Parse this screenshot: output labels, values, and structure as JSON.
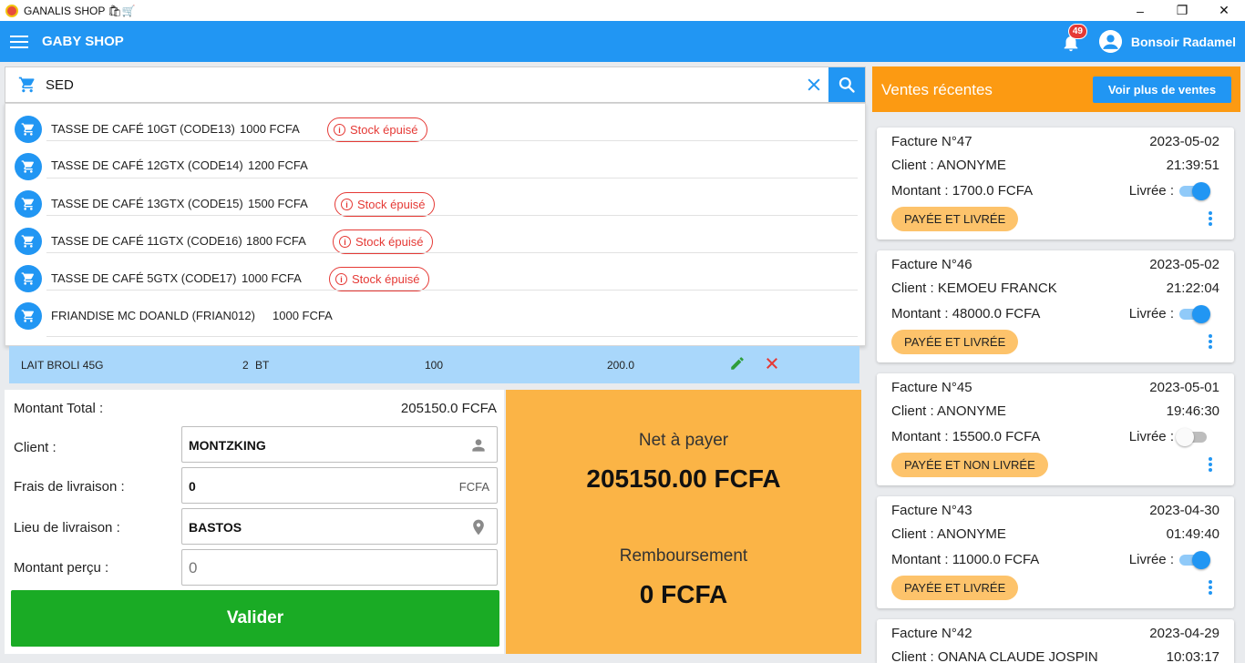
{
  "window": {
    "title": "GANALIS SHOP 🛍🛒",
    "minimize": "–",
    "restore": "❐",
    "close": "✕"
  },
  "appbar": {
    "app_name": "GABY SHOP",
    "notification_count": "49",
    "greeting": "Bonsoir Radamel"
  },
  "search": {
    "value": "SED"
  },
  "suggestions": [
    {
      "name": "TASSE DE CAFÉ 10GT (CODE13)",
      "price": "1000 FCFA",
      "stock": "Stock épuisé"
    },
    {
      "name": "TASSE DE CAFÉ 12GTX (CODE14)",
      "price": "1200 FCFA",
      "stock": ""
    },
    {
      "name": "TASSE DE CAFÉ 13GTX (CODE15)",
      "price": "1500 FCFA",
      "stock": "Stock épuisé"
    },
    {
      "name": "TASSE DE CAFÉ 11GTX (CODE16)",
      "price": "1800 FCFA",
      "stock": "Stock épuisé"
    },
    {
      "name": "TASSE DE CAFÉ 5GTX (CODE17)",
      "price": "1000 FCFA",
      "stock": "Stock épuisé"
    },
    {
      "name": "FRIANDISE MC DOANLD (FRIAN012)",
      "price": "1000 FCFA",
      "stock": ""
    }
  ],
  "cart_row": {
    "product": "LAIT BROLI 45G",
    "quantity": "2",
    "unit": "BT",
    "price": "100",
    "total": "200.0"
  },
  "form": {
    "total_label": "Montant Total :",
    "total_value": "205150.0 FCFA",
    "client_label": "Client :",
    "client_value": "MONTZKING",
    "delivery_fee_label": "Frais de livraison :",
    "delivery_fee_value": "0",
    "delivery_fee_suffix": "FCFA",
    "delivery_place_label": "Lieu de livraison :",
    "delivery_place_value": "BASTOS",
    "received_label": "Montant perçu :",
    "received_value": "0",
    "validate_label": "Valider"
  },
  "summary": {
    "net_label": "Net à payer",
    "net_value": "205150.00 FCFA",
    "refund_label": "Remboursement",
    "refund_value": "0 FCFA"
  },
  "recent": {
    "title": "Ventes récentes",
    "more_label": "Voir plus de ventes",
    "livree_label": "Livrée :",
    "invoices": [
      {
        "title": "Facture N°47",
        "date": "2023-05-02",
        "client": "Client : ANONYME",
        "time": "21:39:51",
        "amount": "Montant : 1700.0 FCFA",
        "delivered": true,
        "status": "PAYÉE ET LIVRÉE"
      },
      {
        "title": "Facture N°46",
        "date": "2023-05-02",
        "client": "Client : KEMOEU FRANCK",
        "time": "21:22:04",
        "amount": "Montant : 48000.0 FCFA",
        "delivered": true,
        "status": "PAYÉE ET LIVRÉE"
      },
      {
        "title": "Facture N°45",
        "date": "2023-05-01",
        "client": "Client : ANONYME",
        "time": "19:46:30",
        "amount": "Montant : 15500.0 FCFA",
        "delivered": false,
        "status": "PAYÉE ET NON LIVRÉE"
      },
      {
        "title": "Facture N°43",
        "date": "2023-04-30",
        "client": "Client : ANONYME",
        "time": "01:49:40",
        "amount": "Montant : 11000.0 FCFA",
        "delivered": true,
        "status": "PAYÉE ET LIVRÉE"
      },
      {
        "title": "Facture N°42",
        "date": "2023-04-29",
        "client": "Client : ONANA CLAUDE JOSPIN",
        "time": "10:03:17",
        "amount": "",
        "delivered": true,
        "status": ""
      }
    ]
  },
  "colors": {
    "primary": "#2196f3",
    "orange_header": "#fc9a12",
    "summary_bg": "#fbb446",
    "validate_green": "#1aab25",
    "stock_red": "#e53935",
    "status_chip": "#fdc36b",
    "cart_row_bg": "#a9d7fb"
  }
}
